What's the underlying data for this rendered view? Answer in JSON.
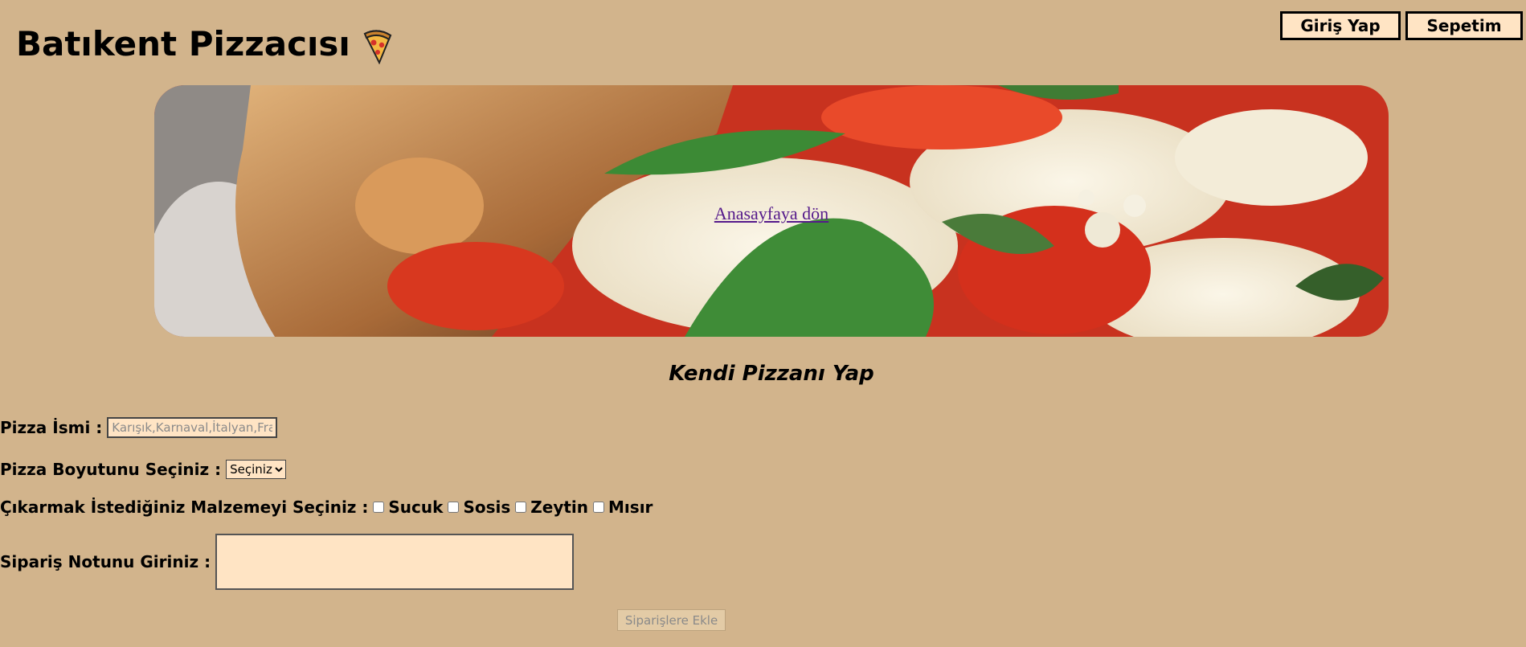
{
  "header": {
    "title": "Batıkent Pizzacısı",
    "title_icon": "pizza-icon",
    "login_label": "Giriş Yap",
    "cart_label": "Sepetim"
  },
  "hero": {
    "link_label": "Anasayfaya dön"
  },
  "form": {
    "title": "Kendi Pizzanı Yap",
    "name_label": "Pizza İsmi :",
    "name_placeholder": "Karışık,Karnaval,İtalyan,Fransız",
    "name_value": "",
    "size_label": "Pizza Boyutunu Seçiniz :",
    "size_selected": "Seçiniz",
    "extras_label": "Çıkarmak İstediğiniz Malzemeyi Seçiniz :",
    "extras": [
      {
        "label": "Sucuk",
        "checked": false
      },
      {
        "label": "Sosis",
        "checked": false
      },
      {
        "label": "Zeytin",
        "checked": false
      },
      {
        "label": "Mısır",
        "checked": false
      }
    ],
    "note_label": "Sipariş Notunu Giriniz :",
    "note_value": "",
    "submit_label": "Siparişlere Ekle"
  },
  "colors": {
    "background": "#d2b48c",
    "button_bg": "#ffe4c4",
    "link": "#551a8b"
  }
}
